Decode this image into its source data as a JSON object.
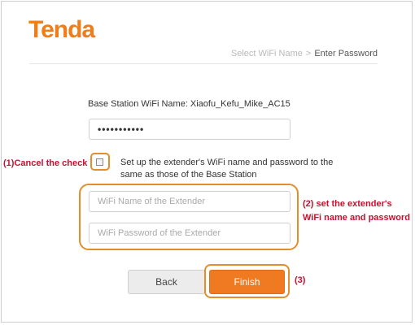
{
  "brand": {
    "logo_text": "Tenda",
    "accent_color": "#ef7d1a"
  },
  "breadcrumb": {
    "step1": "Select WiFi Name",
    "separator": ">",
    "step2": "Enter Password"
  },
  "base_station": {
    "label": "Base Station WiFi Name:",
    "value": "Xiaofu_Kefu_Mike_AC15",
    "password_masked": "•••••••••••"
  },
  "same_as_base": {
    "checked": false,
    "label": "Set up the extender's WiFi name and password to the same as those of the Base Station"
  },
  "extender": {
    "name_placeholder": "WiFi Name of the Extender",
    "password_placeholder": "WiFi Password of the Extender"
  },
  "buttons": {
    "back": "Back",
    "finish": "Finish"
  },
  "annotations": {
    "cancel_check": "(1)Cancel the check",
    "set_line1": "(2) set the extender's",
    "set_line2": "WiFi name and password",
    "finish_step": "(3)",
    "highlight_color": "#e38d2b",
    "text_color": "#c8102e"
  }
}
